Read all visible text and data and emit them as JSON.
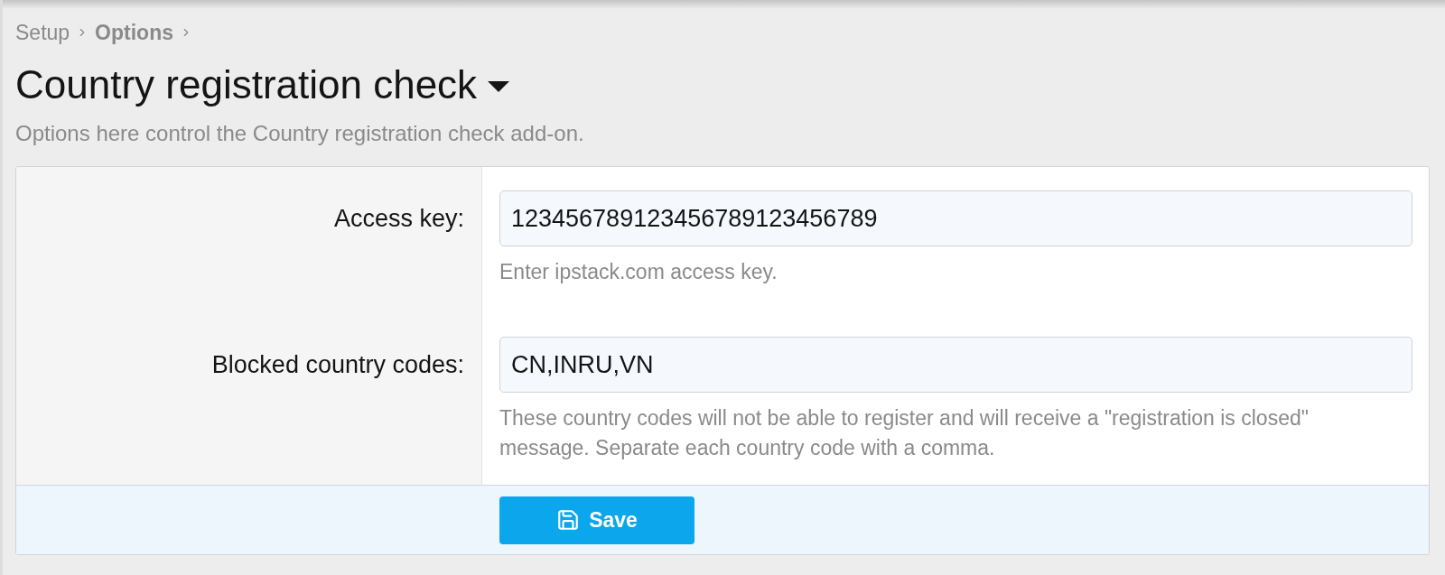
{
  "breadcrumb": [
    {
      "label": "Setup",
      "current": false
    },
    {
      "label": "Options",
      "current": true
    }
  ],
  "title": "Country registration check",
  "description": "Options here control the Country registration check add-on.",
  "options": [
    {
      "label": "Access key:",
      "value": "123456789123456789123456789",
      "hint": "Enter ipstack.com access key."
    },
    {
      "label": "Blocked country codes:",
      "value": "CN,INRU,VN",
      "hint": "These country codes will not be able to register and will receive a \"registration is closed\" message. Separate each country code with a comma."
    }
  ],
  "submit": {
    "label": "Save"
  }
}
